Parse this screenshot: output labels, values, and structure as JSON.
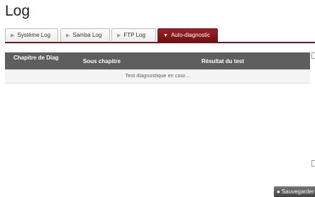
{
  "page": {
    "title": "Log"
  },
  "tabs": [
    {
      "label": "Système Log",
      "active": false
    },
    {
      "label": "Samba Log",
      "active": false
    },
    {
      "label": "FTP Log",
      "active": false
    },
    {
      "label": "Auto-diagnostic",
      "active": true
    }
  ],
  "table": {
    "columns": [
      "Chapitre de Diag",
      "Sous chapitre",
      "Résultat du test"
    ],
    "status": "Test diagnostique en cour..."
  },
  "actions": {
    "save_label": "Sauvegarder"
  },
  "colors": {
    "accent": "#7a1419",
    "header": "#5e5e5e"
  }
}
